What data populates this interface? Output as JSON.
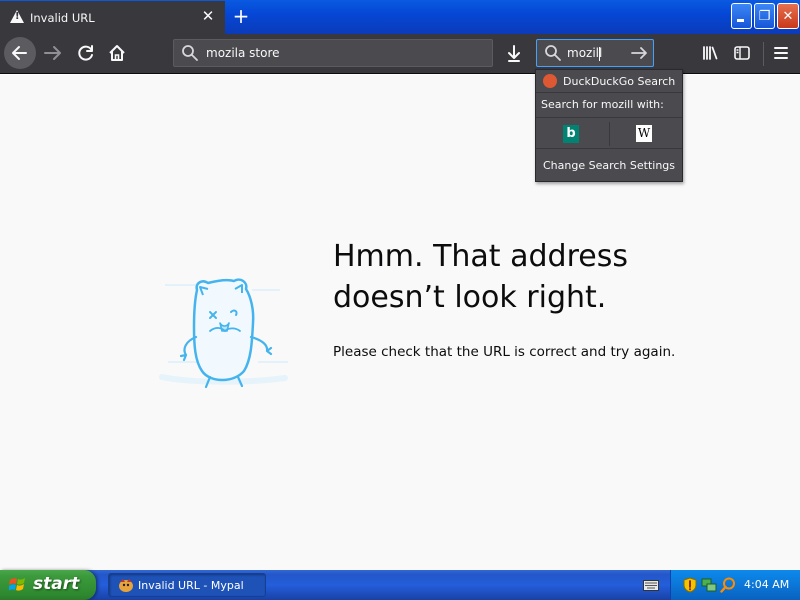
{
  "browser": {
    "tab": {
      "title": "Invalid URL",
      "close_glyph": "✕"
    },
    "new_tab_glyph": "+",
    "urlbar": {
      "value": "mozila store"
    },
    "searchbar": {
      "value": "mozill"
    },
    "window_buttons": {
      "maximize_glyph": "❐",
      "close_glyph": "✕"
    }
  },
  "search_popup": {
    "default_engine": "DuckDuckGo Search",
    "search_for_label": "Search for mozill with:",
    "engines": [
      "bing-icon",
      "wikipedia-icon"
    ],
    "wiki_glyph": "W",
    "bing_glyph": "b",
    "settings_label": "Change Search Settings"
  },
  "error_page": {
    "heading_line1": "Hmm. That address",
    "heading_line2": "doesn’t look right.",
    "message": "Please check that the URL is correct and try again."
  },
  "taskbar": {
    "start_label": "start",
    "item_label": "Invalid URL - Mypal",
    "clock": "4:04 AM"
  },
  "colors": {
    "toolbar": "#38383d",
    "field": "#4a4a4f",
    "focus_ring": "#45a1ff",
    "content_bg": "#f9f9fa",
    "illustration_accent": "#45b4ee",
    "titlebar_blue": "#0a5ae0",
    "start_green": "#3c9a3c"
  }
}
